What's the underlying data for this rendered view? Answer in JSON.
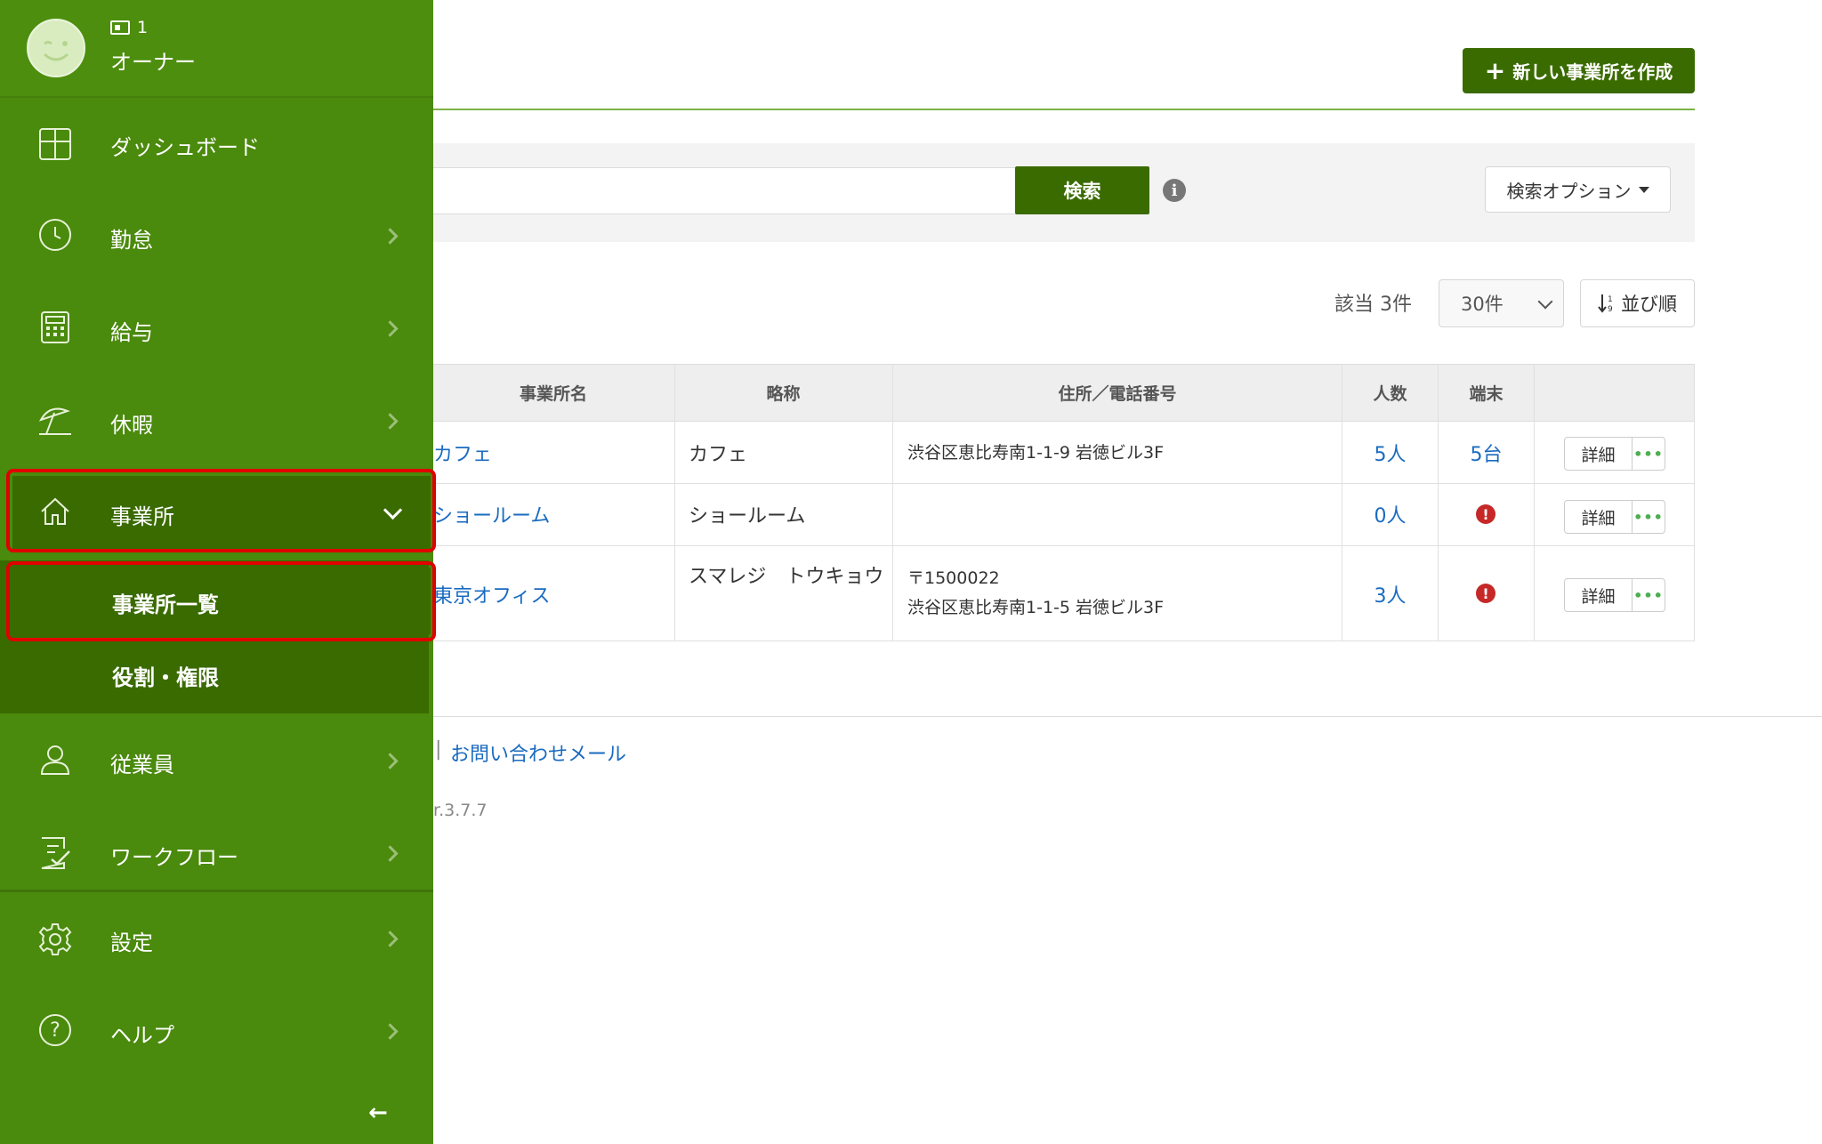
{
  "header": {
    "create_button": "新しい事業所を作成"
  },
  "search": {
    "value": "",
    "placeholder": "",
    "button": "検索",
    "options_button": "検索オプション"
  },
  "results": {
    "count": "該当 3件",
    "page_size": "30件",
    "sort_button": "並び順"
  },
  "table": {
    "columns": [
      "事業所名",
      "略称",
      "住所／電話番号",
      "人数",
      "端末"
    ],
    "rows": [
      {
        "name": "カフェ",
        "abbr": "カフェ",
        "addr1": "渋谷区恵比寿南1-1-9 岩徳ビル3F",
        "addr2": "",
        "people": "5人",
        "devices": "5台",
        "detail": "詳細",
        "more": "•••"
      },
      {
        "name": "ショールーム",
        "abbr": "ショールーム",
        "addr1": "",
        "addr2": "",
        "people": "0人",
        "devices": "!",
        "detail": "詳細",
        "more": "•••"
      },
      {
        "name": "東京オフィス",
        "abbr": "スマレジ　トウキョウ",
        "addr1": "〒1500022",
        "addr2": "渋谷区恵比寿南1-1-5 岩徳ビル3F",
        "people": "3人",
        "devices": "!",
        "detail": "詳細",
        "more": "•••"
      }
    ]
  },
  "footer": {
    "separator": "|",
    "contact_link": "お問い合わせメール",
    "version": "r.3.7.7"
  },
  "sidebar": {
    "user": {
      "id": "1",
      "role": "オーナー"
    },
    "items": [
      {
        "label": "ダッシュボード",
        "icon": "dashboard-icon"
      },
      {
        "label": "勤怠",
        "icon": "clock-icon"
      },
      {
        "label": "給与",
        "icon": "calculator-icon"
      },
      {
        "label": "休暇",
        "icon": "beach-umbrella-icon"
      },
      {
        "label": "事業所",
        "icon": "home-icon"
      },
      {
        "label": "従業員",
        "icon": "user-icon"
      },
      {
        "label": "ワークフロー",
        "icon": "checklist-icon"
      },
      {
        "label": "設定",
        "icon": "gear-icon"
      },
      {
        "label": "ヘルプ",
        "icon": "help-icon"
      }
    ],
    "subitems": [
      {
        "label": "事業所一覧"
      },
      {
        "label": "役割・権限"
      }
    ],
    "collapse": "←"
  },
  "colors": {
    "sidebar": "#4a8a0c",
    "active": "#3a6b00",
    "primary_button": "#3a6b00",
    "link": "#1a6bc0",
    "highlight": "#e00000",
    "alert": "#c62828"
  }
}
